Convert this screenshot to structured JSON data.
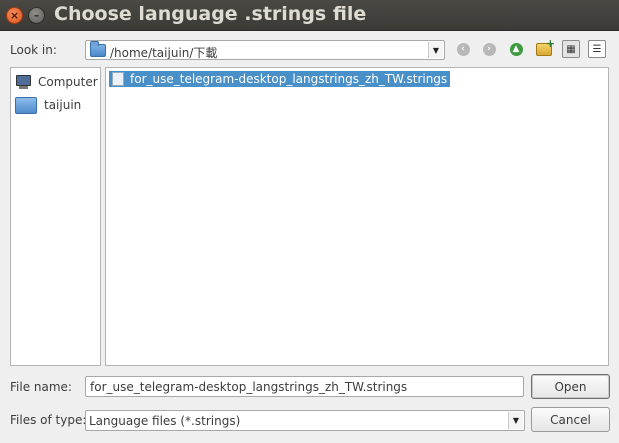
{
  "window": {
    "title": "Choose language .strings file",
    "close_glyph": "×",
    "minimize_glyph": "–"
  },
  "look_in": {
    "label": "Look in:",
    "path": "/home/taijuin/下載"
  },
  "toolbar": {
    "icons": [
      "back-icon",
      "forward-icon",
      "parent-directory-icon",
      "new-folder-icon",
      "icon-view-icon",
      "detail-view-icon"
    ]
  },
  "sidebar": {
    "items": [
      {
        "label": "Computer",
        "icon": "computer-icon"
      },
      {
        "label": "taijuin",
        "icon": "folder-icon"
      }
    ]
  },
  "files": [
    {
      "name": "for_use_telegram-desktop_langstrings_zh_TW.strings",
      "selected": true
    }
  ],
  "file_name": {
    "label": "File name:",
    "value": "for_use_telegram-desktop_langstrings_zh_TW.strings"
  },
  "file_type": {
    "label": "Files of type:",
    "value": "Language files (*.strings)"
  },
  "buttons": {
    "open": "Open",
    "cancel": "Cancel"
  },
  "colors": {
    "titlebar": "#3b3a36",
    "selection": "#4a90c8",
    "close_button": "#e0571f"
  }
}
